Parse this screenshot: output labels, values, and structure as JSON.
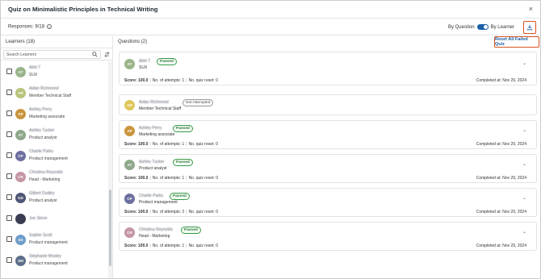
{
  "header": {
    "title": "Quiz on Minimalistic Principles in Technical Writing",
    "close": "×"
  },
  "responses": {
    "label": "Responses: 9/18",
    "info": "i"
  },
  "view_toggle": {
    "left": "By Question",
    "right": "By Learner"
  },
  "sidebar": {
    "heading": "Learners",
    "count": "(18)",
    "search_placeholder": "Search Learners",
    "learners": [
      {
        "initials": "AT",
        "color": "#9bb58a",
        "name": "Abhi T",
        "role": "SUX"
      },
      {
        "initials": "AR",
        "color": "#b7c47a",
        "name": "Aidan Richmond",
        "role": "Member Technical Staff"
      },
      {
        "initials": "AP",
        "color": "#c9963d",
        "name": "Ashley Perry",
        "role": "Marketing associate"
      },
      {
        "initials": "AT",
        "color": "#8fa88b",
        "name": "Ashley Tucker",
        "role": "Product analyst"
      },
      {
        "initials": "CP",
        "color": "#6c6f9e",
        "name": "Charlie Parks",
        "role": "Product management"
      },
      {
        "initials": "CR",
        "color": "#c596a3",
        "name": "Christina Reynolds",
        "role": "Head - Marketing"
      },
      {
        "initials": "GD",
        "color": "#4f5575",
        "name": "Gilbert Dudley",
        "role": "Product analyst"
      },
      {
        "initials": "",
        "color": "#3a3d52",
        "name": "Joe Stone",
        "role": ""
      },
      {
        "initials": "SS",
        "color": "#6f9ec9",
        "name": "Sophie Scott",
        "role": "Product management"
      },
      {
        "initials": "SM",
        "color": "#5b6f8a",
        "name": "Stephanie Mosley",
        "role": "Product management"
      }
    ]
  },
  "main": {
    "questions_label": "Questions",
    "questions_count": "(2)",
    "reset_button": "Reset All Failed Quiz",
    "cards": [
      {
        "initials": "AT",
        "color": "#9bb58a",
        "name": "Abhi T",
        "status": "Passed",
        "role": "SUX",
        "score": "100.0",
        "attempts": "1",
        "reset": "0",
        "completed": "Nov 29, 2024",
        "expandable": true
      },
      {
        "initials": "AR",
        "color": "#e0c75a",
        "name": "Aidan Richmond",
        "status": "Not Attempted",
        "role": "Member Technical Staff",
        "score": "",
        "attempts": "",
        "reset": "",
        "completed": "",
        "expandable": false
      },
      {
        "initials": "AP",
        "color": "#c9963d",
        "name": "Ashley Perry",
        "status": "Passed",
        "role": "Marketing associate",
        "score": "100.0",
        "attempts": "1",
        "reset": "0",
        "completed": "Nov 29, 2024",
        "expandable": true
      },
      {
        "initials": "AT",
        "color": "#8fa88b",
        "name": "Ashley Tucker",
        "status": "Passed",
        "role": "Product analyst",
        "score": "100.0",
        "attempts": "1",
        "reset": "0",
        "completed": "Nov 29, 2024",
        "expandable": true
      },
      {
        "initials": "CP",
        "color": "#6c6f9e",
        "name": "Charlie Parks",
        "status": "Passed",
        "role": "Product management",
        "score": "100.0",
        "attempts": "2",
        "reset": "0",
        "completed": "Nov 29, 2024",
        "expandable": true
      },
      {
        "initials": "CR",
        "color": "#c596a3",
        "name": "Christina Reynolds",
        "status": "Passed",
        "role": "Head - Marketing",
        "score": "100.0",
        "attempts": "1",
        "reset": "0",
        "completed": "Nov 29, 2024",
        "expandable": true
      }
    ],
    "labels": {
      "score": "Score:",
      "attempts": "No. of attempts:",
      "reset": "No. quiz reset:",
      "completed": "Completed at:"
    }
  },
  "colors": {
    "accent": "#1b5fa8",
    "highlight": "#d9541e",
    "passed": "#2e7d3a"
  },
  "icons": {
    "download": "download-icon",
    "search": "search-icon",
    "sort": "sort-icon",
    "chevron": "chevron-down-icon",
    "close": "close-icon",
    "info": "info-icon"
  }
}
